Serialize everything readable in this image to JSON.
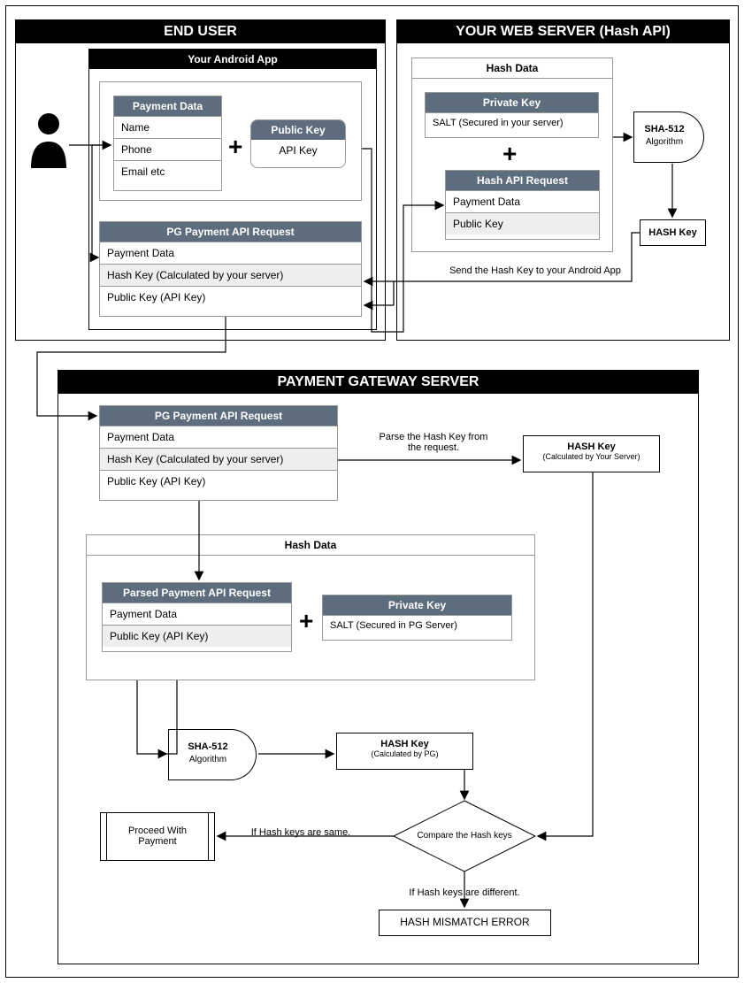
{
  "sections": {
    "endUser": "END USER",
    "webServer": "YOUR WEB SERVER (Hash API)",
    "gateway": "PAYMENT GATEWAY SERVER"
  },
  "app": {
    "title": "Your Android App",
    "paymentData": {
      "hdr": "Payment Data",
      "rows": [
        "Name",
        "Phone",
        "Email etc"
      ]
    },
    "publicKey": {
      "hdr": "Public Key",
      "row": "API Key"
    },
    "pgReq": {
      "hdr": "PG Payment API Request",
      "r1": "Payment Data",
      "r2": "Hash Key (Calculated by your server)",
      "r3": "Public Key (API Key)"
    }
  },
  "server": {
    "hashData": "Hash Data",
    "privateKey": {
      "hdr": "Private Key",
      "row": "SALT (Secured in your server)"
    },
    "hashReq": {
      "hdr": "Hash API Request",
      "r1": "Payment Data",
      "r2": "Public Key"
    },
    "sha": {
      "t": "SHA-512",
      "s": "Algorithm"
    },
    "hashKey": "HASH Key",
    "sendNote": "Send the Hash Key to your Android App"
  },
  "pg": {
    "req": {
      "hdr": "PG Payment API Request",
      "r1": "Payment Data",
      "r2": "Hash Key (Calculated by your server)",
      "r3": "Public Key (API Key)"
    },
    "parseNote": "Parse the Hash Key from\nthe request.",
    "parsedHash": {
      "t": "HASH Key",
      "s": "(Calculated by Your Server)"
    },
    "hashData": "Hash Data",
    "parsedReq": {
      "hdr": "Parsed Payment API Request",
      "r1": "Payment Data",
      "r2": "Public Key (API Key)"
    },
    "privateKey": {
      "hdr": "Private Key",
      "row": "SALT (Secured in PG Server)"
    },
    "sha": {
      "t": "SHA-512",
      "s": "Algorithm"
    },
    "calcHash": {
      "t": "HASH Key",
      "s": "(Calculated by PG)"
    },
    "compare": "Compare the Hash keys",
    "same": "If Hash keys are same.",
    "diff": "If Hash keys are different.",
    "proceed": "Proceed With\nPayment",
    "mismatch": "HASH MISMATCH ERROR"
  }
}
